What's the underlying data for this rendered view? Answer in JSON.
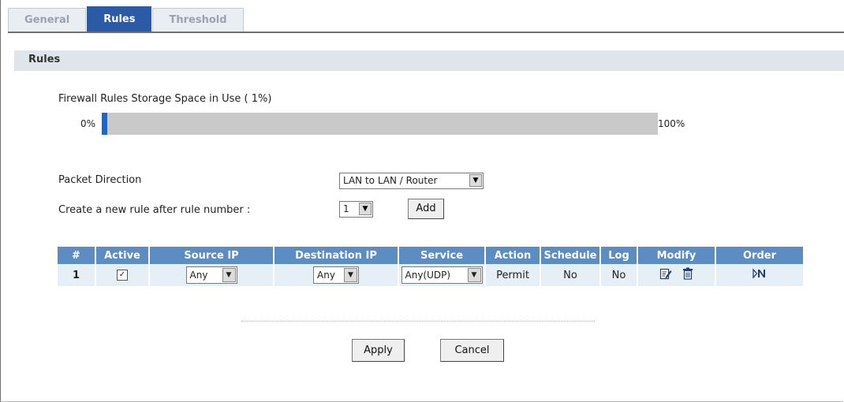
{
  "tabs": [
    "General",
    "Rules",
    "Threshold"
  ],
  "active_tab": "Rules",
  "section_title": "Rules",
  "storage": {
    "label": "Firewall Rules Storage Space in Use  ( 1%)",
    "min_label": "0%",
    "max_label": "100%",
    "percent": 1
  },
  "packet_direction": {
    "label": "Packet Direction",
    "value": "LAN to LAN / Router"
  },
  "new_rule": {
    "label": "Create a new rule after rule number :",
    "value": "1",
    "add_label": "Add"
  },
  "table": {
    "headers": [
      "#",
      "Active",
      "Source IP",
      "Destination IP",
      "Service",
      "Action",
      "Schedule",
      "Log",
      "Modify",
      "Order"
    ],
    "rows": [
      {
        "num": "1",
        "active": true,
        "source_ip": "Any",
        "destination_ip": "Any",
        "service": "Any(UDP)",
        "action": "Permit",
        "schedule": "No",
        "log": "No"
      }
    ]
  },
  "buttons": {
    "apply": "Apply",
    "cancel": "Cancel"
  },
  "colors": {
    "tab_active": "#2b5aa6",
    "table_header": "#5b8cc2",
    "table_row": "#e6eef6",
    "bar_fill": "#1569d6",
    "bar_track": "#c9c9c9",
    "section_bar": "#dfe5ea"
  },
  "icons": {
    "edit": "edit-icon",
    "delete": "trash-icon",
    "move": "move-order-icon"
  }
}
